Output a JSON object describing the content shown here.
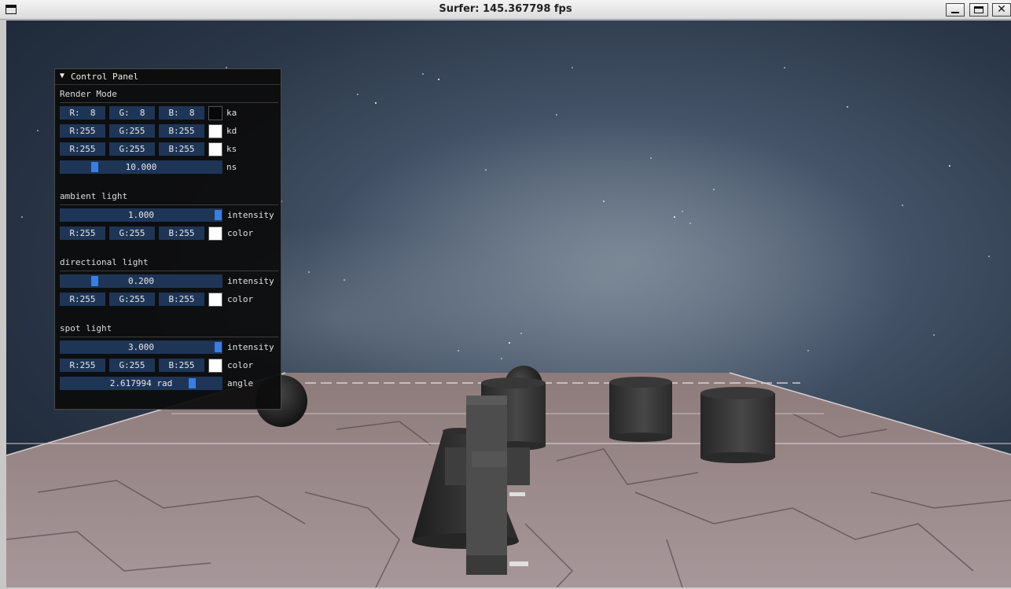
{
  "window": {
    "title": "Surfer: 145.367798 fps"
  },
  "panel": {
    "title": "Control Panel",
    "render_mode": {
      "heading": "Render Mode",
      "rows": [
        {
          "r": "R:  8",
          "g": "G:  8",
          "b": "B:  8",
          "label": "ka",
          "swatch": "#080808"
        },
        {
          "r": "R:255",
          "g": "G:255",
          "b": "B:255",
          "label": "kd",
          "swatch": "#ffffff"
        },
        {
          "r": "R:255",
          "g": "G:255",
          "b": "B:255",
          "label": "ks",
          "swatch": "#ffffff"
        }
      ],
      "ns": {
        "value": "10.000",
        "label": "ns",
        "fraction": 0.2
      }
    },
    "ambient": {
      "heading": "ambient light",
      "intensity": {
        "value": "1.000",
        "label": "intensity",
        "fraction": 1.0
      },
      "color": {
        "r": "R:255",
        "g": "G:255",
        "b": "B:255",
        "label": "color",
        "swatch": "#ffffff"
      }
    },
    "directional": {
      "heading": "directional light",
      "intensity": {
        "value": "0.200",
        "label": "intensity",
        "fraction": 0.2
      },
      "color": {
        "r": "R:255",
        "g": "G:255",
        "b": "B:255",
        "label": "color",
        "swatch": "#ffffff"
      }
    },
    "spot": {
      "heading": "spot light",
      "intensity": {
        "value": "3.000",
        "label": "intensity",
        "fraction": 1.0
      },
      "color": {
        "r": "R:255",
        "g": "G:255",
        "b": "B:255",
        "label": "color",
        "swatch": "#ffffff"
      },
      "angle": {
        "value": "2.617994 rad",
        "label": "angle",
        "fraction": 0.83
      }
    }
  },
  "colors": {
    "field": "#1e3556",
    "knob": "#3b7de0",
    "floor": "#9c8a8a",
    "object": "#3a3a3a"
  }
}
